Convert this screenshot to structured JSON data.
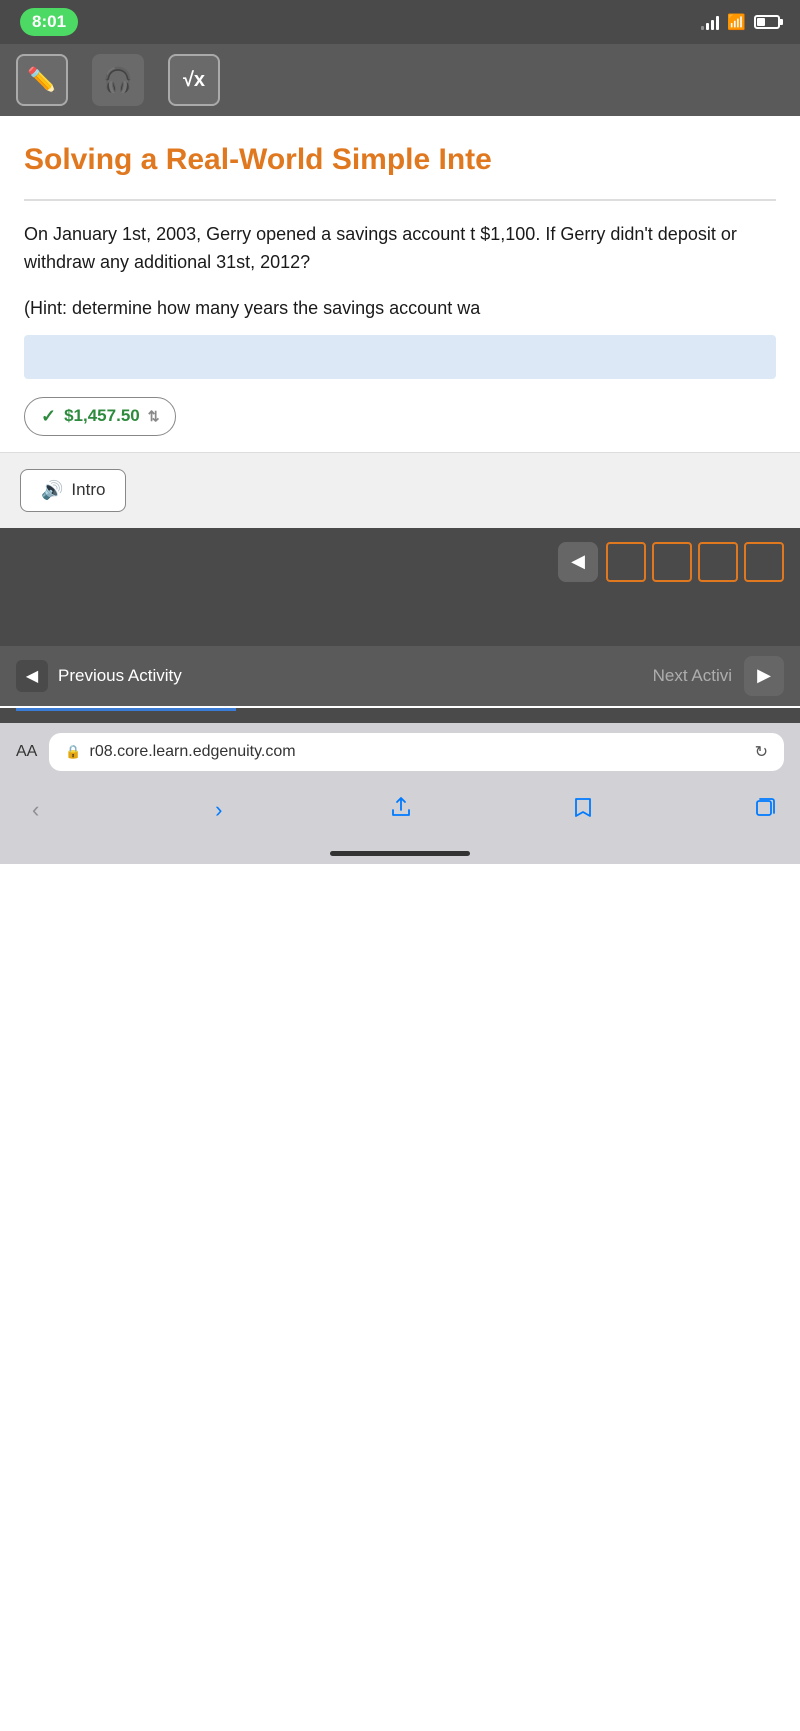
{
  "statusBar": {
    "time": "8:01",
    "url": "r08.core.learn.edgenuity.com"
  },
  "toolbar": {
    "pencilLabel": "pencil",
    "headphoneLabel": "headphone",
    "mathLabel": "√x"
  },
  "page": {
    "title": "Solving a Real-World Simple Inte",
    "problemText": "On January 1st, 2003, Gerry opened a savings account t $1,100. If Gerry didn't deposit or withdraw any additional 31st, 2012?",
    "hintText": "(Hint: determine how many years the savings account wa",
    "answerValue": "$1,457.50",
    "introLabel": "Intro"
  },
  "navigation": {
    "prevLabel": "Previous Activity",
    "nextLabel": "Next Activi",
    "aaLabel": "AA"
  }
}
